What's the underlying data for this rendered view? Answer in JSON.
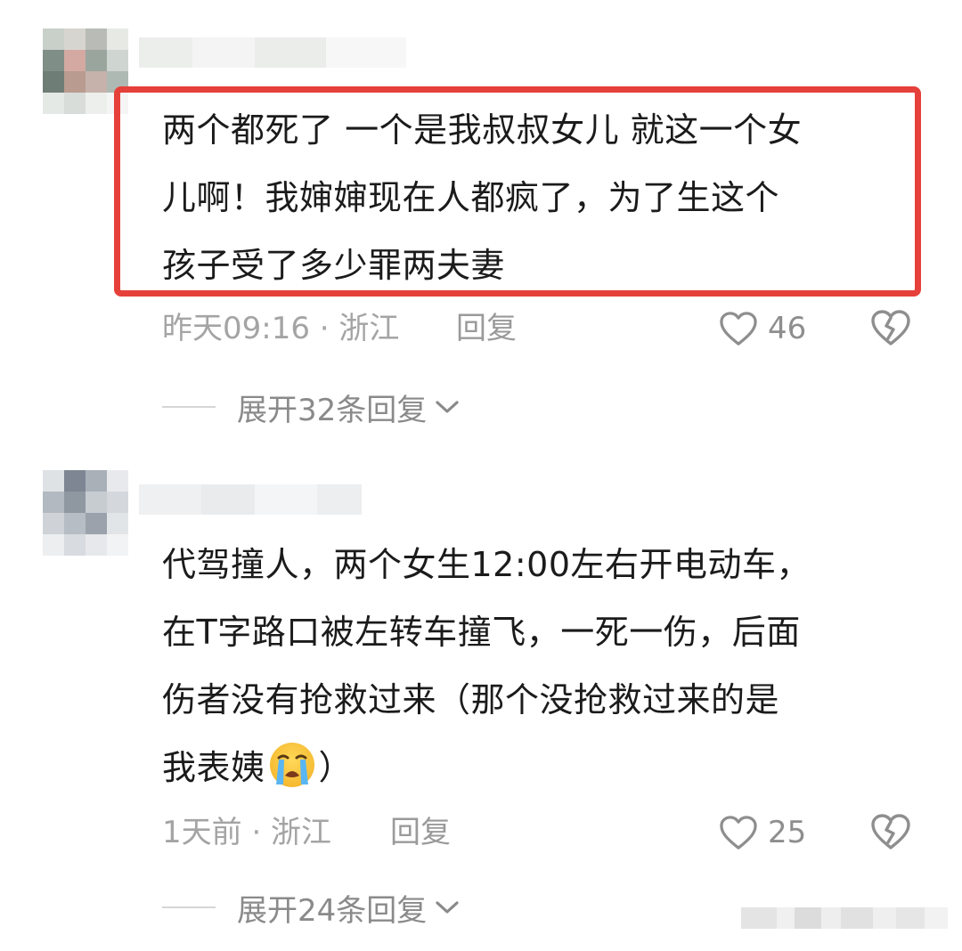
{
  "comments": [
    {
      "lines": [
        "两个都死了 一个是我叔叔女儿 就这一个女",
        "儿啊！我婶婶现在人都疯了，为了生这个",
        "孩子受了多少罪两夫妻"
      ],
      "time_location": "昨天09:16 · 浙江",
      "reply_label": "回复",
      "like_count": "46",
      "expand_label": "展开32条回复",
      "highlighted": true
    },
    {
      "lines": [
        "代驾撞人，两个女生12:00左右开电动车，",
        "在T字路口被左转车撞飞，一死一伤，后面",
        "伤者没有抢救过来（那个没抢救过来的是"
      ],
      "last_line_before_emoji": "我表姨",
      "last_line_after_emoji": "）",
      "emoji_icon": "loudly-crying-face-emoji",
      "time_location": "1天前 · 浙江",
      "reply_label": "回复",
      "like_count": "25",
      "expand_label": "展开24条回复",
      "highlighted": false
    }
  ],
  "icons": {
    "like": "heart-outline-icon",
    "dislike": "broken-heart-icon",
    "expand": "chevron-down-icon"
  },
  "colors": {
    "highlight_border": "#e6403a",
    "meta_text": "#a4a4a4",
    "icon_stroke": "#8e8e8e"
  }
}
